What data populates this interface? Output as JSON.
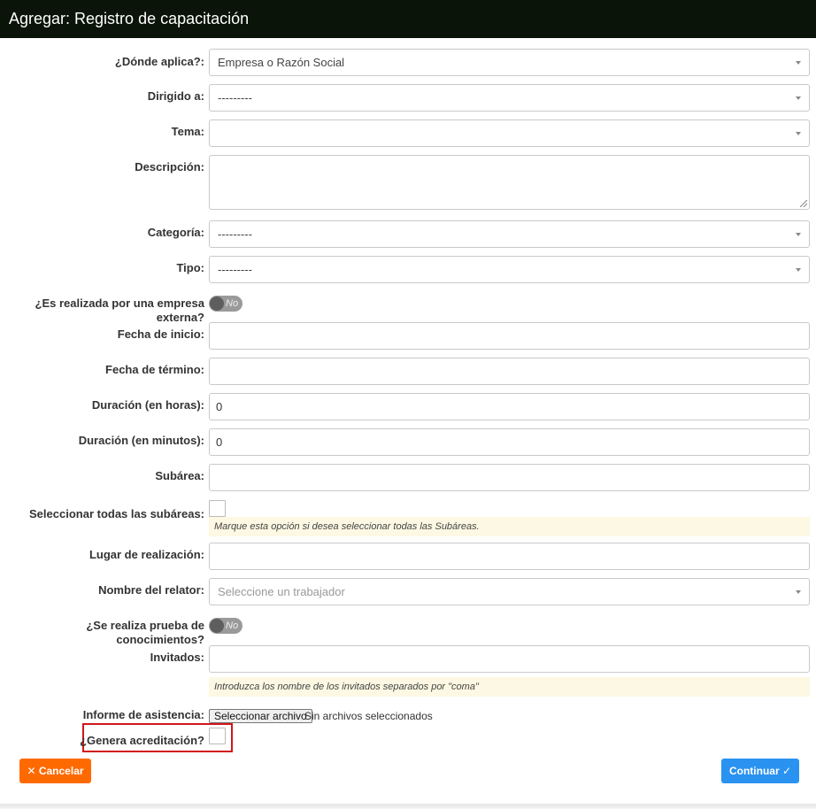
{
  "header": {
    "title": "Agregar: Registro de capacitación"
  },
  "form": {
    "donde_aplica": {
      "label": "¿Dónde aplica?:",
      "value": "Empresa o Razón Social"
    },
    "dirigido_a": {
      "label": "Dirigido a:",
      "value": "---------"
    },
    "tema": {
      "label": "Tema:",
      "value": ""
    },
    "descripcion": {
      "label": "Descripción:",
      "value": ""
    },
    "categoria": {
      "label": "Categoría:",
      "value": "---------"
    },
    "tipo": {
      "label": "Tipo:",
      "value": "---------"
    },
    "empresa_externa": {
      "label": "¿Es realizada por una empresa externa?",
      "toggle_text": "No"
    },
    "fecha_inicio": {
      "label": "Fecha de inicio:",
      "value": ""
    },
    "fecha_termino": {
      "label": "Fecha de término:",
      "value": ""
    },
    "duracion_horas": {
      "label": "Duración (en horas):",
      "value": "0"
    },
    "duracion_minutos": {
      "label": "Duración (en minutos):",
      "value": "0"
    },
    "subarea": {
      "label": "Subárea:",
      "value": ""
    },
    "todas_subareas": {
      "label": "Seleccionar todas las subáreas:",
      "help": "Marque esta opción si desea seleccionar todas las Subáreas."
    },
    "lugar": {
      "label": "Lugar de realización:",
      "value": ""
    },
    "relator": {
      "label": "Nombre del relator:",
      "placeholder": "Seleccione un trabajador"
    },
    "prueba": {
      "label": "¿Se realiza prueba de conocimientos?",
      "toggle_text": "No"
    },
    "invitados": {
      "label": "Invitados:",
      "value": "",
      "help": "Introduzca los nombre de los invitados separados por \"coma\""
    },
    "informe": {
      "label": "Informe de asistencia:",
      "button": "Seleccionar archivo",
      "status": "Sin archivos seleccionados"
    },
    "acreditacion": {
      "label": "¿Genera acreditación?"
    }
  },
  "actions": {
    "cancel": "✕ Cancelar",
    "continue": "Continuar ✓"
  },
  "colors": {
    "header_bg": "#0b1409",
    "cancel": "#ff6a00",
    "continue": "#2a92f0",
    "highlight": "#d0171b",
    "help_bg": "#fcf8e3"
  }
}
